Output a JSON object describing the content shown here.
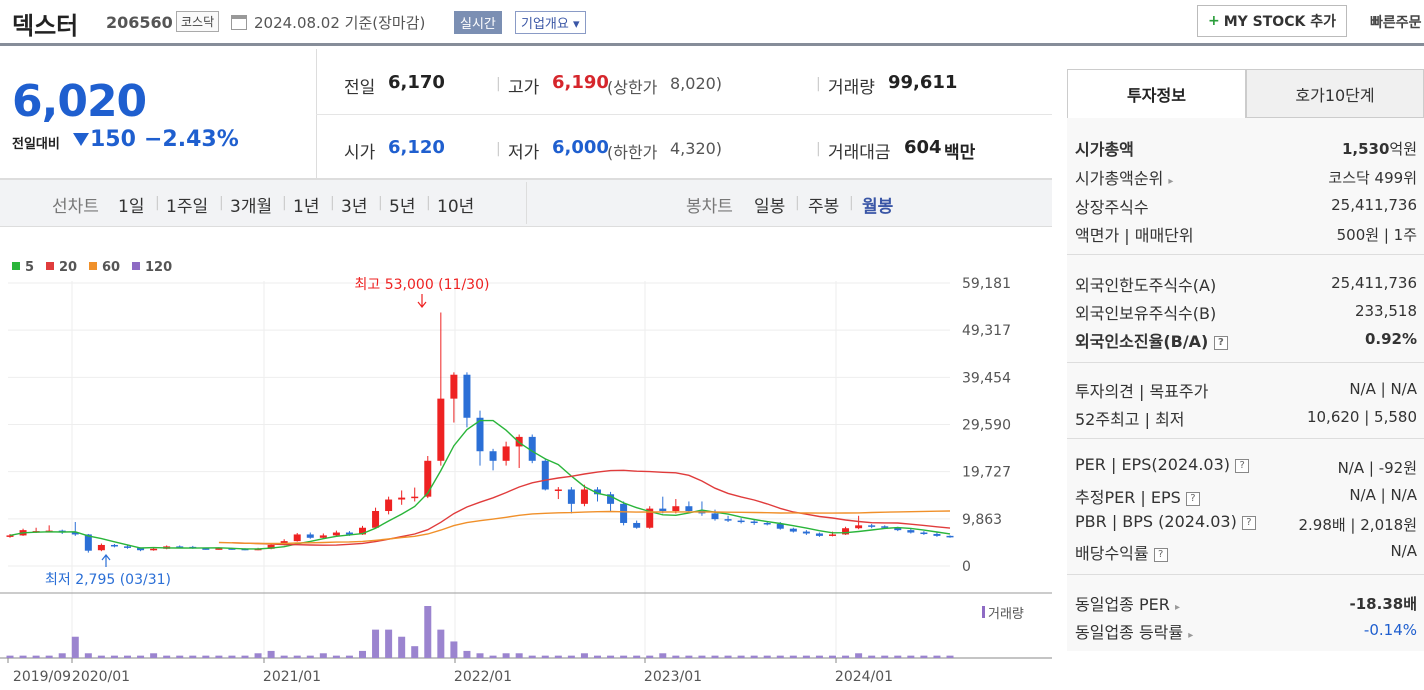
{
  "header": {
    "name": "덱스터",
    "code": "206560",
    "market": "코스닥",
    "date": "2024.08.02 기준(장마감)",
    "realtime": "실시간",
    "company": "기업개요 ▾",
    "mystock": "MY STOCK 추가",
    "mystock_plus": "+",
    "quick": "빠른주문"
  },
  "price": {
    "current": "6,020",
    "change_label": "전일대비",
    "change_icon": "triangle-down",
    "change": "150",
    "change_pct": "−2.43%",
    "prev_label": "전일",
    "prev": "6,170",
    "high_label": "고가",
    "high": "6,190",
    "upper_label": "(상한가",
    "upper": "8,020)",
    "volume_label": "거래량",
    "volume": "99,611",
    "open_label": "시가",
    "open": "6,120",
    "low_label": "저가",
    "low": "6,000",
    "lower_label": "(하한가",
    "lower": "4,320)",
    "amount_label": "거래대금",
    "amount": "604",
    "amount_unit": "백만"
  },
  "periods": {
    "line_label": "선차트",
    "line": [
      "1일",
      "1주일",
      "3개월",
      "1년",
      "3년",
      "5년",
      "10년"
    ],
    "candle_label": "봉차트",
    "candle": [
      "일봉",
      "주봉",
      "월봉"
    ]
  },
  "chart_data": {
    "type": "candlestick",
    "legend": [
      {
        "name": "5",
        "color": "#2ab53a"
      },
      {
        "name": "20",
        "color": "#e03c3c"
      },
      {
        "name": "60",
        "color": "#f0902a"
      },
      {
        "name": "120",
        "color": "#8e6bc4"
      }
    ],
    "y_ticks": [
      "59,181",
      "49,317",
      "39,454",
      "29,590",
      "19,727",
      "9,863",
      "0"
    ],
    "x_ticks": [
      "2019/09",
      "2020/01",
      "2021/01",
      "2022/01",
      "2023/01",
      "2024/01"
    ],
    "high_annotation": "최고 53,000 (11/30)",
    "low_annotation": "최저 2,795 (03/31)",
    "volume_label": "거래량",
    "ylim": [
      0,
      59181
    ]
  },
  "invest": {
    "tab1": "투자정보",
    "tab2": "호가10단계",
    "rows1": [
      {
        "label": "시가총액",
        "value": "1,530",
        "unit": "억원"
      },
      {
        "label": "시가총액순위",
        "value": "코스닥 499위"
      },
      {
        "label": "상장주식수",
        "value": "25,411,736"
      },
      {
        "label": "액면가 | 매매단위",
        "value": "500원 | 1주"
      }
    ],
    "rows2": [
      {
        "label": "외국인한도주식수(A)",
        "value": "25,411,736"
      },
      {
        "label": "외국인보유주식수(B)",
        "value": "233,518"
      },
      {
        "label": "외국인소진율(B/A)",
        "value": "0.92%"
      }
    ],
    "rows3": [
      {
        "label": "투자의견 | 목표주가",
        "value": "N/A | N/A"
      },
      {
        "label": "52주최고 | 최저",
        "value": "10,620 | 5,580"
      }
    ],
    "rows4": [
      {
        "label": "PER | EPS(2024.03)",
        "value": "N/A | -92원"
      },
      {
        "label": "추정PER | EPS",
        "value": "N/A | N/A"
      },
      {
        "label": "PBR | BPS (2024.03)",
        "value": "2.98배 | 2,018원"
      },
      {
        "label": "배당수익률",
        "value": "N/A"
      }
    ],
    "rows5": [
      {
        "label": "동일업종 PER",
        "value": "-18.38배"
      },
      {
        "label": "동일업종 등락률",
        "value": "-0.14%"
      }
    ]
  }
}
